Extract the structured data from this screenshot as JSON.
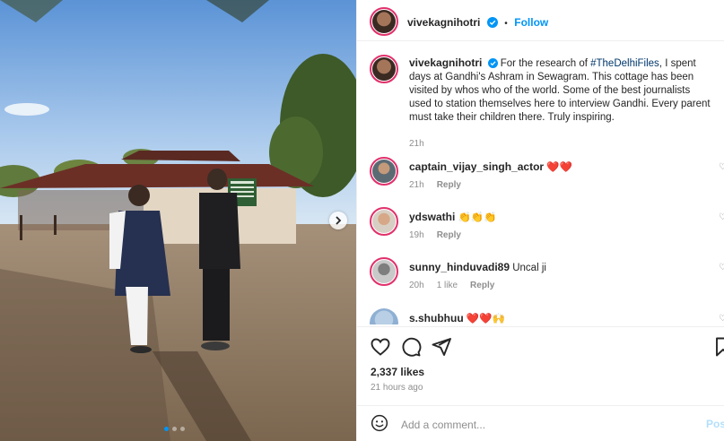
{
  "colors": {
    "accent": "#0095f6",
    "hashtag": "#00376b",
    "muted": "#8e8e8e",
    "heart": "#e0001b"
  },
  "photo": {
    "carousel_index": 1,
    "carousel_count": 3,
    "sign_text": ""
  },
  "header": {
    "username": "vivekagnihotri",
    "separator": "•",
    "follow_label": "Follow"
  },
  "caption": {
    "username": "vivekagnihotri",
    "text_before": " For the research of ",
    "hashtag": "#TheDelhiFiles",
    "text_after": ", I spent days at Gandhi's Ashram in Sewagram. This cottage has been visited by whos who of the world. Some of the best journalists used to station themselves here to interview Gandhi. Every parent must take their children there. Truly inspiring.",
    "time": "21h"
  },
  "comments": [
    {
      "username": "captain_vijay_singh_actor",
      "text": " ❤️❤️",
      "time": "21h",
      "likes": "",
      "reply": "Reply"
    },
    {
      "username": "ydswathi",
      "text": " 👏👏👏",
      "time": "19h",
      "likes": "",
      "reply": "Reply"
    },
    {
      "username": "sunny_hinduvadi89",
      "text": " Uncal ji",
      "time": "20h",
      "likes": "1 like",
      "reply": "Reply"
    },
    {
      "username": "s.shubhuu",
      "text": " ❤️❤️🙌",
      "time": "",
      "likes": "",
      "reply": ""
    }
  ],
  "actions": {
    "like": "heart-icon",
    "comment": "comment-icon",
    "share": "share-icon",
    "save": "bookmark-icon"
  },
  "likes": "2,337 likes",
  "timestamp": "21 hours ago",
  "add_comment": {
    "placeholder": "Add a comment...",
    "post_label": "Post"
  }
}
